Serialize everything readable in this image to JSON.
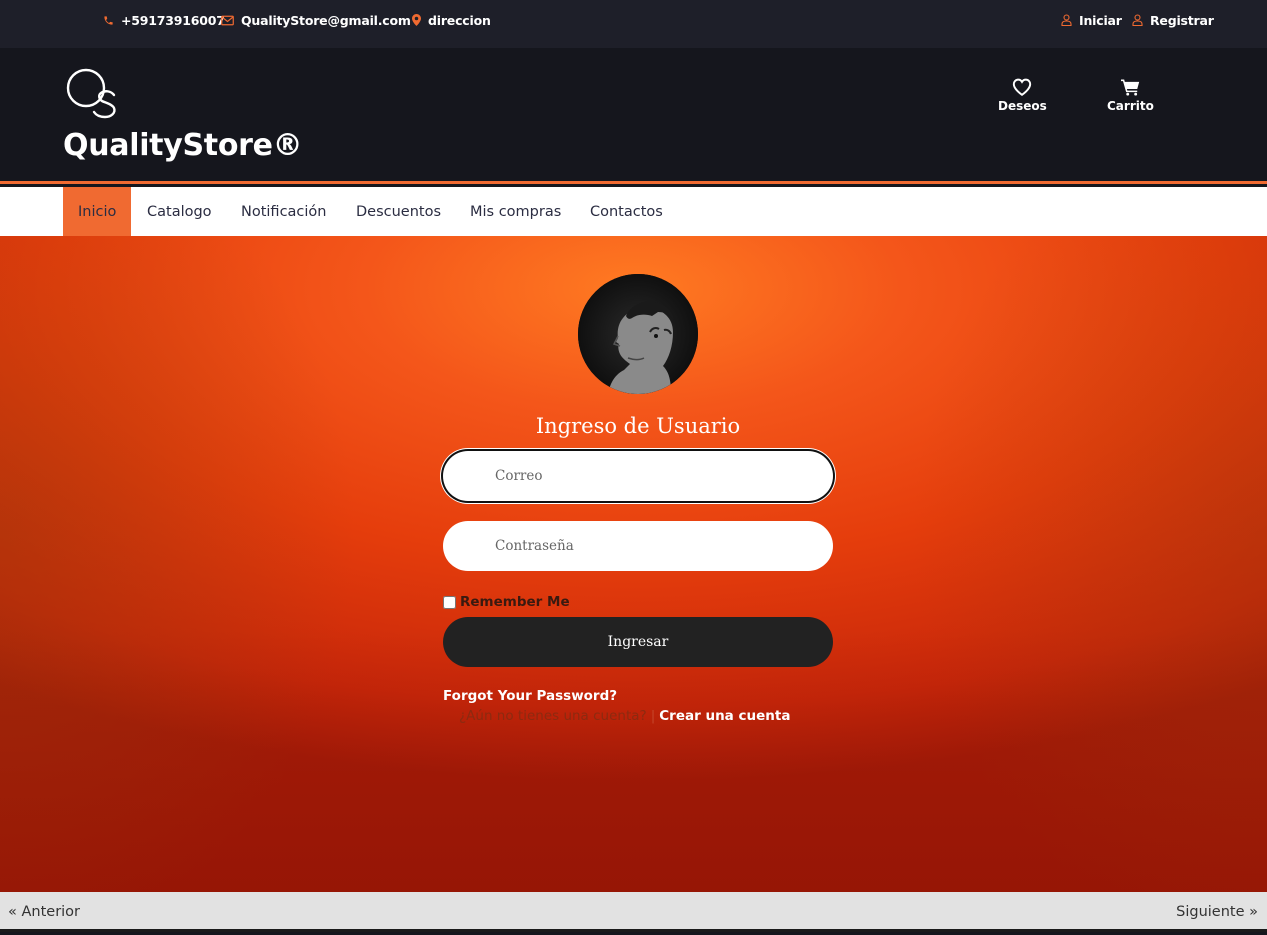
{
  "topbar": {
    "phone": "+59173916007",
    "email": "QualityStore@gmail.com",
    "address": "direccion",
    "login": "Iniciar",
    "register": "Registrar"
  },
  "header": {
    "brand": "QualityStore®",
    "logo_letters": "QS",
    "wishlist": "Deseos",
    "cart": "Carrito"
  },
  "nav": {
    "items": [
      "Inicio",
      "Catalogo",
      "Notificación",
      "Descuentos",
      "Mis compras",
      "Contactos"
    ],
    "active": "Inicio"
  },
  "login": {
    "title": "Ingreso de Usuario",
    "email_placeholder": "Correo",
    "password_placeholder": "Contraseña",
    "remember": "Remember Me",
    "submit": "Ingresar",
    "forgot": "Forgot Your Password?",
    "signup_question": "¿Aún no tienes una cuenta?",
    "signup_separator": "|",
    "signup_link": "Crear una cuenta"
  },
  "pager": {
    "previous": "« Anterior",
    "next": "Siguiente »"
  },
  "colors": {
    "accent": "#f06a31",
    "dark": "#15161d",
    "topbar": "#1e1f29",
    "button": "#222222"
  }
}
